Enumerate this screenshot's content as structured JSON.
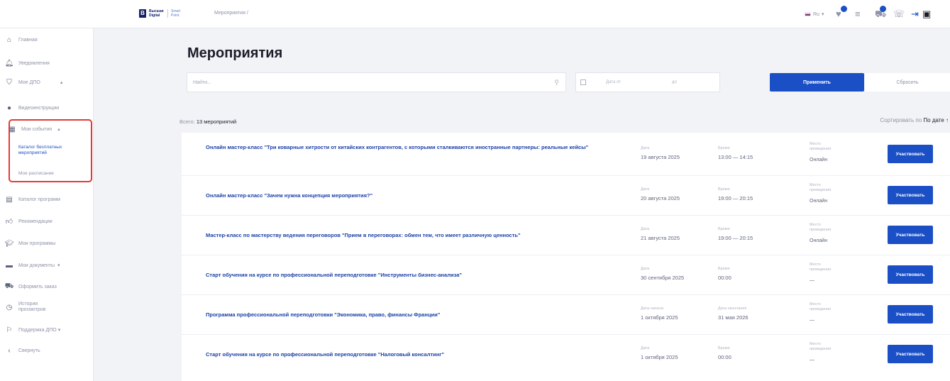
{
  "header": {
    "logo_line1": "Высшая",
    "logo_line2": "Digital",
    "logo_line3": "Smart",
    "logo_line4": "Point",
    "breadcrumb": "Мероприятия",
    "lang": "Ru"
  },
  "sidebar": {
    "items": [
      {
        "label": "Главная",
        "icon": "home-icon"
      },
      {
        "label": "Уведомления",
        "icon": "bell-icon"
      },
      {
        "label": "Мое ДПО",
        "icon": "education-icon"
      },
      {
        "label": "Видеоинструкции",
        "icon": "play-icon"
      },
      {
        "label": "Мои события",
        "icon": "calendar-icon"
      },
      {
        "label": "Каталог программ",
        "icon": "catalog-icon"
      },
      {
        "label": "Рекомендации",
        "icon": "thumbs-up-icon"
      },
      {
        "label": "Мои программы",
        "icon": "graduation-icon"
      },
      {
        "label": "Мои документы",
        "icon": "folder-icon"
      },
      {
        "label": "Оформить заказ",
        "icon": "cart-icon"
      },
      {
        "label": "История просмотров",
        "icon": "clock-icon"
      },
      {
        "label": "Поддержка ДПО",
        "icon": "support-icon"
      },
      {
        "label": "Свернуть",
        "icon": "collapse-icon"
      }
    ],
    "sub_catalog": "Каталог бесплатных мероприятий",
    "sub_schedule": "Мое расписание"
  },
  "main": {
    "title": "Мероприятия",
    "search_placeholder": "Найти...",
    "date_from": "Дата от",
    "date_to": "до",
    "apply": "Применить",
    "reset": "Сбросить",
    "total_prefix": "Всего:",
    "total_value": "13 мероприятий",
    "sort_prefix": "Сортировать по",
    "sort_value": "По дате ↑",
    "events": [
      {
        "title": "Онлайн мастер-класс \"Три коварные хитрости от китайских контрагентов, с которыми сталкиваются иностранные партнеры: реальные кейсы\"",
        "l1": "Дата",
        "v1": "19 августа 2025",
        "l2": "Время",
        "v2": "13:00 — 14:15",
        "place_label": "Место проведения",
        "place": "Онлайн",
        "button": "Участвовать"
      },
      {
        "title": "Онлайн мастер-класс \"Зачем нужна концепция мероприятия?\"",
        "l1": "Дата",
        "v1": "20 августа 2025",
        "l2": "Время",
        "v2": "19:00 — 20:15",
        "place_label": "Место проведения",
        "place": "Онлайн",
        "button": "Участвовать"
      },
      {
        "title": "Мастер-класс по мастерству ведения переговоров \"Прием в переговорах: обмен тем, что имеет различную ценность\"",
        "l1": "Дата",
        "v1": "21 августа 2025",
        "l2": "Время",
        "v2": "19:00 — 20:15",
        "place_label": "Место проведения",
        "place": "Онлайн",
        "button": "Участвовать"
      },
      {
        "title": "Старт обучения на курсе по профессиональной переподготовке \"Инструменты бизнес-анализа\"",
        "l1": "Дата",
        "v1": "30 сентября 2025",
        "l2": "Время",
        "v2": "00:00",
        "place_label": "Место проведения",
        "place": "—",
        "button": "Участвовать"
      },
      {
        "title": "Программа профессиональной переподготовки \"Экономика, право, финансы Франции\"",
        "l1": "Дата начала",
        "v1": "1 октября 2025",
        "l2": "Дата окончания",
        "v2": "31 мая 2026",
        "place_label": "Место проведения",
        "place": "—",
        "button": "Участвовать"
      },
      {
        "title": "Старт обучения на курсе по профессиональной переподготовке \"Налоговый консалтинг\"",
        "l1": "Дата",
        "v1": "1 октября 2025",
        "l2": "Время",
        "v2": "00:00",
        "place_label": "Место проведения",
        "place": "—",
        "button": "Участвовать"
      }
    ]
  },
  "colors": {
    "accent": "#1b4fc6",
    "highlight": "#e53935"
  }
}
